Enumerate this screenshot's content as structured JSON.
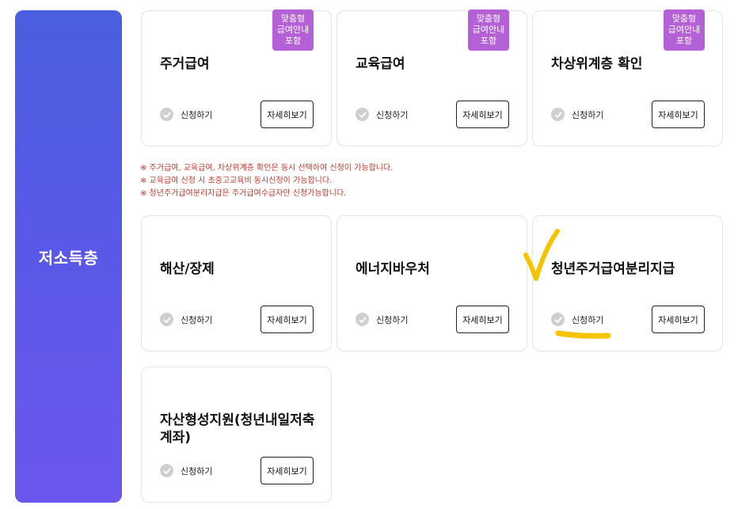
{
  "category": {
    "label": "저소득층"
  },
  "badge": {
    "line1": "맞춤형",
    "line2": "급여안내",
    "line3": "포함"
  },
  "actions": {
    "apply": "신청하기",
    "detail": "자세히보기"
  },
  "cards_top": [
    {
      "title": "주거급여"
    },
    {
      "title": "교육급여"
    },
    {
      "title": "차상위계층 확인"
    }
  ],
  "notices": [
    "※ 주거급여, 교육급여, 차상위계층 확인은 동시 선택하여 신청이 가능합니다.",
    "※ 교육급여 신청 시 초중고교육비 동시신청이 가능합니다.",
    "※ 청년주거급여분리지급은 주거급여수급자만 신청가능합니다."
  ],
  "cards_mid": [
    {
      "title": "해산/장제"
    },
    {
      "title": "에너지바우처"
    },
    {
      "title": "청년주거급여분리지급"
    }
  ],
  "cards_bottom": [
    {
      "title_line1": "자산형성지원(청년내일저축",
      "title_line2": "계좌)"
    }
  ],
  "annotation": {
    "color": "#f5c400"
  },
  "colors": {
    "badge": "#b460d6",
    "notice": "#c0392b",
    "tab_start": "#4a5fdf",
    "tab_end": "#6c57ee"
  }
}
